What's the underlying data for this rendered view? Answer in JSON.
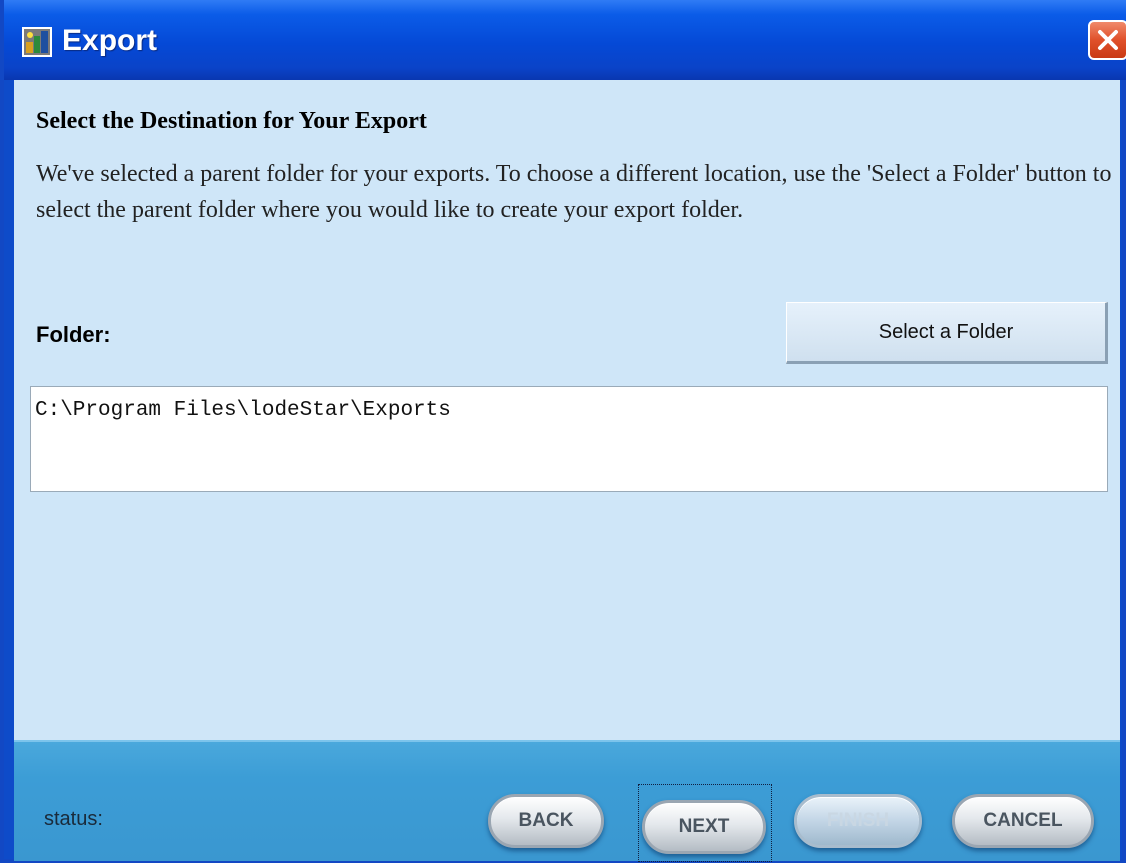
{
  "window": {
    "title": "Export",
    "app_icon": "app-icon",
    "close_icon": "close-icon",
    "title_bar_color": "#0a4fd6",
    "close_button_color": "#e0502a"
  },
  "content": {
    "heading": "Select the Destination for Your Export",
    "description": "We've selected a parent folder for your exports.  To choose a different location, use the 'Select a Folder' button to select the parent folder where you would like to create your export folder.",
    "folder_label": "Folder:",
    "select_folder_button": "Select a Folder",
    "folder_path": "C:\\Program Files\\lodeStar\\Exports",
    "background_color": "#cfe6f8"
  },
  "footer": {
    "status_label": "status:",
    "buttons": {
      "back": "BACK",
      "next": "NEXT",
      "finish": "FINISH",
      "cancel": "CANCEL"
    },
    "finish_enabled": false,
    "focused_button": "NEXT",
    "background_color": "#3c9dd6"
  }
}
